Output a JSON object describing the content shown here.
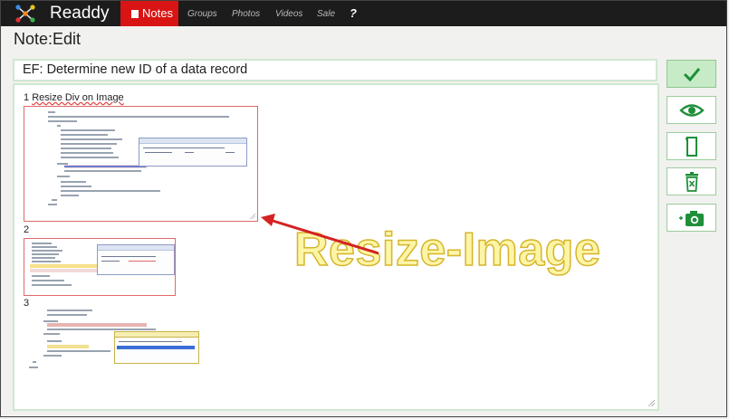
{
  "app": {
    "brand": "Readdy"
  },
  "nav": {
    "items": [
      {
        "label": "Notes",
        "active": true
      },
      {
        "label": "Groups"
      },
      {
        "label": "Photos"
      },
      {
        "label": "Videos"
      },
      {
        "label": "Sale"
      }
    ],
    "help": "?"
  },
  "page": {
    "title": "Note:Edit"
  },
  "note": {
    "title": "EF: Determine new ID of a data record",
    "items": [
      {
        "label_prefix": "1 ",
        "label_text": "Resize Div on Image"
      },
      {
        "label_prefix": "2",
        "label_text": ""
      },
      {
        "label_prefix": "3",
        "label_text": ""
      }
    ],
    "overlay_text": "Resize-Image"
  },
  "sidebar": {
    "buttons": [
      {
        "name": "save",
        "icon": "checkmark-icon"
      },
      {
        "name": "preview",
        "icon": "eye-icon"
      },
      {
        "name": "document",
        "icon": "document-icon"
      },
      {
        "name": "delete",
        "icon": "trash-icon"
      },
      {
        "name": "add-photo",
        "icon": "camera-icon"
      }
    ]
  },
  "colors": {
    "accent_green": "#1f8f3a",
    "nav_active_red": "#d91414",
    "selection_red": "#e06868",
    "arrow_red": "#d42222",
    "overlay_fill": "#fdf5a6",
    "overlay_stroke": "#d6b52c"
  }
}
